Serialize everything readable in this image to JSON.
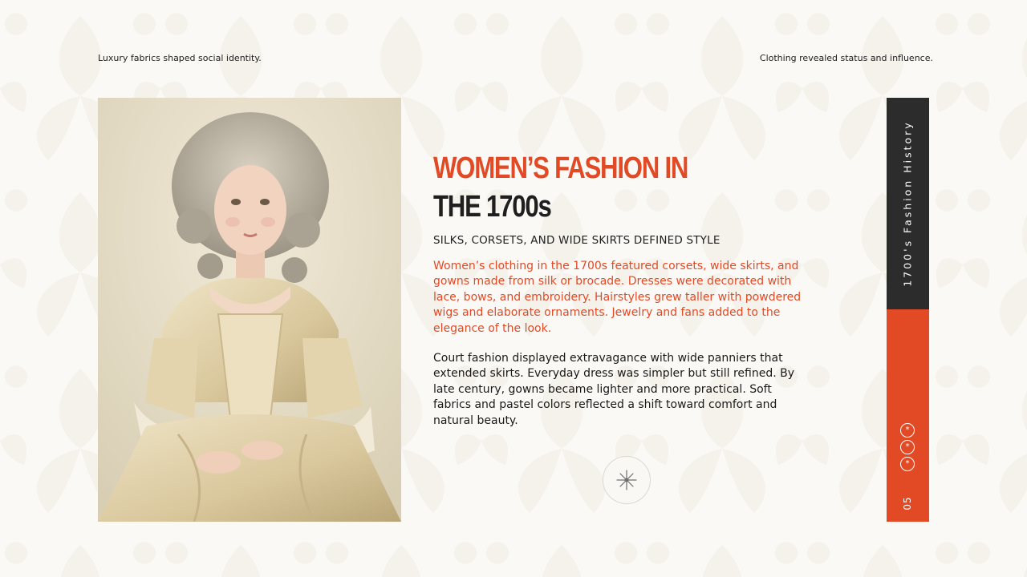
{
  "header": {
    "left_caption": "Luxury fabrics shaped social identity.",
    "right_caption": "Clothing revealed status and influence."
  },
  "title": {
    "line1": "WOMEN’S FASHION IN",
    "line2": "THE 1700s"
  },
  "subheading": "SILKS, CORSETS, AND WIDE SKIRTS DEFINED STYLE",
  "paragraphs": {
    "highlight": "Women’s clothing in the 1700s featured corsets, wide skirts, and gowns made from silk or brocade. Dresses were decorated with lace, bows, and embroidery. Hairstyles grew taller with powdered wigs and elaborate ornaments. Jewelry and fans added to the elegance of the look.",
    "body": "Court fashion displayed extravagance with wide panniers that extended skirts. Everyday dress was simpler but still refined. By late century, gowns became lighter and more practical. Soft fabrics and pastel colors reflected a shift toward comfort and natural beauty."
  },
  "sidebar": {
    "label": "1700's Fashion History",
    "page_number": "05",
    "dot_glyph": "*"
  },
  "icons": {
    "portrait": "woman-portrait-painting",
    "badge": "sparkle-star-icon"
  },
  "colors": {
    "accent": "#e24a25",
    "dark": "#2c2c2c",
    "background": "#fbf9f6"
  }
}
